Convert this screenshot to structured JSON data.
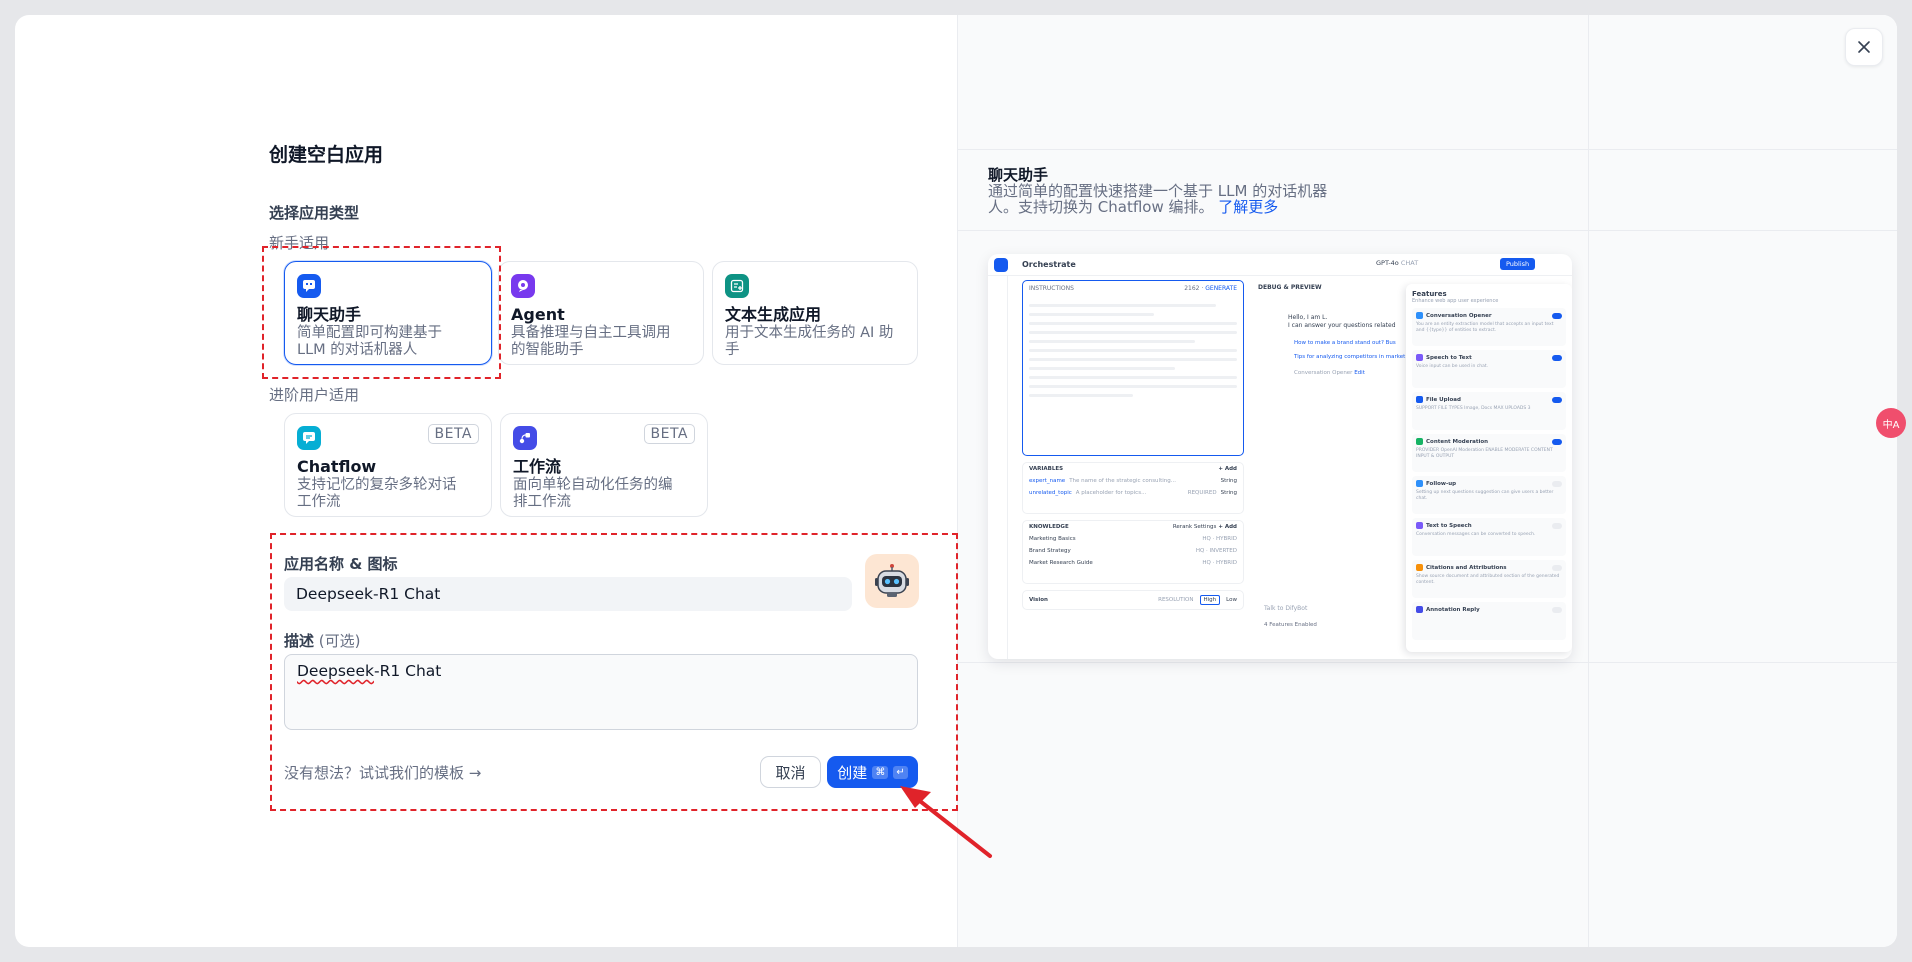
{
  "dialog": {
    "title": "创建空白应用",
    "app_type_label": "选择应用类型",
    "beginner_label": "新手适用",
    "advanced_label": "进阶用户适用",
    "beginner_types": [
      {
        "name": "聊天助手",
        "desc_line1": "简单配置即可构建基于",
        "desc_line2": "LLM 的对话机器人",
        "icon": "chat-icon",
        "color": "#155aef",
        "selected": true
      },
      {
        "name": "Agent",
        "desc_line1": "具备推理与自主工具调用",
        "desc_line2": "的智能助手",
        "icon": "agent-icon",
        "color": "#7839ee",
        "selected": false
      },
      {
        "name": "文本生成应用",
        "desc_line1": "用于文本生成任务的 AI 助",
        "desc_line2": "手",
        "icon": "text-gen-icon",
        "color": "#0e9384",
        "selected": false
      }
    ],
    "advanced_types": [
      {
        "name": "Chatflow",
        "desc_line1": "支持记忆的复杂多轮对话",
        "desc_line2": "工作流",
        "badge": "BETA",
        "icon": "chatflow-icon",
        "color": "#06aed4"
      },
      {
        "name": "工作流",
        "desc_line1": "面向单轮自动化任务的编",
        "desc_line2": "排工作流",
        "badge": "BETA",
        "icon": "workflow-icon",
        "color": "#444ce7"
      }
    ],
    "name_icon_label": "应用名称 & 图标",
    "name_value": "Deepseek-R1 Chat",
    "desc_label": "描述",
    "desc_optional": "(可选)",
    "desc_value_word": "Deepseek",
    "desc_value_rest": "-R1 Chat",
    "template_link": "没有想法？试试我们的模板 →",
    "cancel_label": "取消",
    "create_label": "创建",
    "create_kbd1": "⌘",
    "create_kbd2": "↵"
  },
  "preview_panel": {
    "title": "聊天助手",
    "desc_line1": "通过简单的配置快速搭建一个基于 LLM 的对话机器",
    "desc_line2": "人。支持切换为 Chatflow 编排。",
    "learn_more": "了解更多",
    "orchestrate": "Orchestrate",
    "model": "GPT-4o",
    "model_mode": "CHAT",
    "publish": "Publish",
    "instructions": "INSTRUCTIONS",
    "instructions_count": "2162",
    "generate": "GENERATE",
    "debug_preview": "DEBUG & PREVIEW",
    "greeting_line1": "Hello, I am L.",
    "greeting_line2": "I can answer your questions related",
    "suggestion1": "How to make a brand stand out?",
    "suggestion1_suffix": "Bus",
    "suggestion2": "Tips for analyzing competitors in market",
    "opener_note": "Conversation Opener",
    "opener_edit": "Edit",
    "variables": "VARIABLES",
    "add": "+ Add",
    "vars": [
      {
        "name": "expert_name",
        "desc": "The name of the strategic consulting...",
        "type": "String",
        "required": ""
      },
      {
        "name": "unrelated_topic",
        "desc": "A placeholder for topics...",
        "type": "String",
        "required": "REQUIRED"
      }
    ],
    "knowledge": "KNOWLEDGE",
    "rerank": "Rerank Settings",
    "knowledge_items": [
      {
        "name": "Marketing Basics",
        "tag": "HQ · HYBRID"
      },
      {
        "name": "Brand Strategy",
        "tag": "HQ · INVERTED"
      },
      {
        "name": "Market Research Guide",
        "tag": "HQ · HYBRID"
      }
    ],
    "vision": "Vision",
    "resolution": "RESOLUTION",
    "high": "High",
    "low": "Low",
    "talk_placeholder": "Talk to DifyBot",
    "features_enabled": "4 Features Enabled",
    "features_title": "Features",
    "features_sub": "Enhance web app user experience",
    "features": [
      {
        "name": "Conversation Opener",
        "desc": "You are an entity extraction model that accepts an input text and {{type}} of entities to extract.",
        "on": true,
        "color": "#2e90fa"
      },
      {
        "name": "Speech to Text",
        "desc": "Voice input can be used in chat.",
        "on": true,
        "color": "#7a5af8"
      },
      {
        "name": "File Upload",
        "desc": "SUPPORT FILE TYPES  Image, Docs    MAX UPLOADS 3",
        "on": true,
        "color": "#155aef"
      },
      {
        "name": "Content Moderation",
        "desc": "PROVIDER OpenAI Moderation   ENABLE MODERATE CONTENT INPUT & OUTPUT",
        "on": true,
        "color": "#16b364"
      },
      {
        "name": "Follow-up",
        "desc": "Setting up next questions suggestion can give users a better chat.",
        "on": false,
        "color": "#2e90fa"
      },
      {
        "name": "Text to Speech",
        "desc": "Conversation messages can be converted to speech.",
        "on": false,
        "color": "#7a5af8"
      },
      {
        "name": "Citations and Attributions",
        "desc": "Show source document and attributed section of the generated content.",
        "on": false,
        "color": "#f79009"
      },
      {
        "name": "Annotation Reply",
        "desc": "",
        "on": false,
        "color": "#444ce7"
      }
    ]
  },
  "side_badge": "中A"
}
